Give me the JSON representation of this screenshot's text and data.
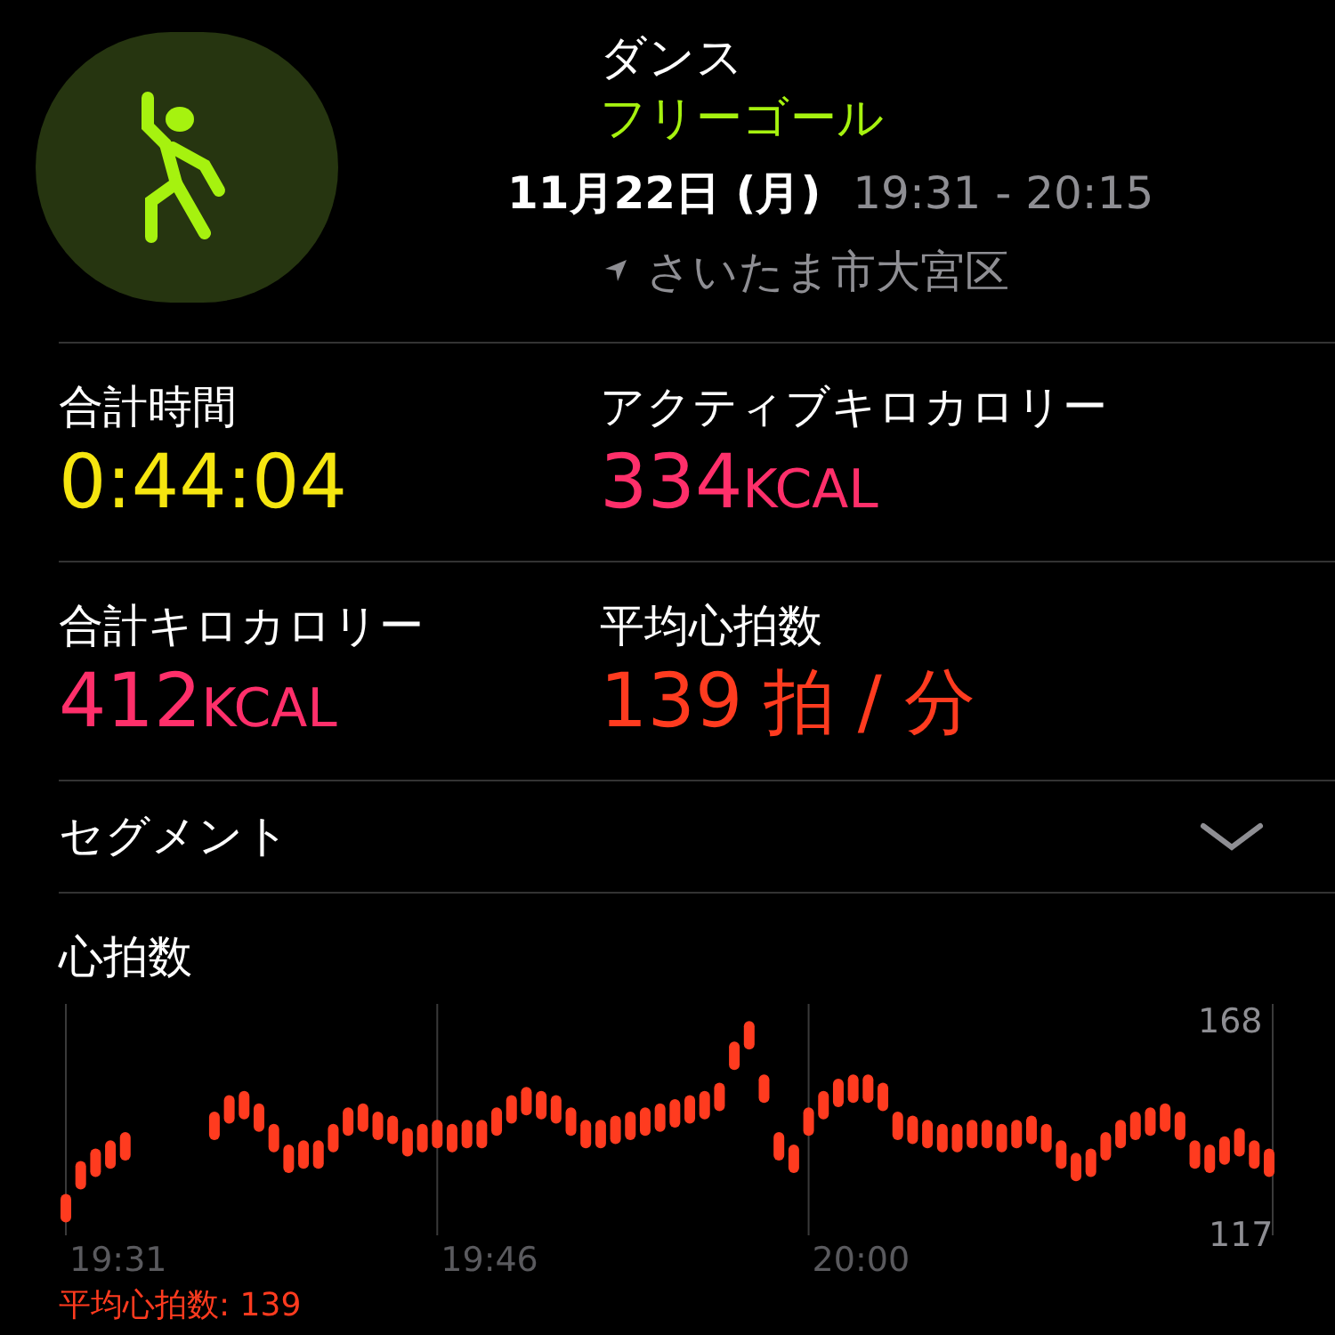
{
  "workout": {
    "name": "ダンス",
    "goal": "フリーゴール",
    "date": "11月22日 (月)",
    "time": "19:31 - 20:15",
    "location": "さいたま市大宮区"
  },
  "metrics": [
    {
      "label": "合計時間",
      "value": "0:44:04",
      "color": "#f5e50f"
    },
    {
      "label": "アクティブキロカロリー",
      "value": "334",
      "unit": "KCAL",
      "color": "#ff2f6a"
    },
    {
      "label": "合計キロカロリー",
      "value": "412",
      "unit": "KCAL",
      "color": "#ff2f6a"
    },
    {
      "label": "平均心拍数",
      "value": "139",
      "unit": "拍 / 分",
      "color": "#ff3b1f"
    }
  ],
  "segments": {
    "label": "セグメント",
    "expanded": false
  },
  "heart_rate": {
    "title": "心拍数",
    "max_label": "168",
    "min_label": "117",
    "time_labels": [
      "19:31",
      "19:46",
      "20:00"
    ],
    "average": "平均心拍数: 139"
  }
}
